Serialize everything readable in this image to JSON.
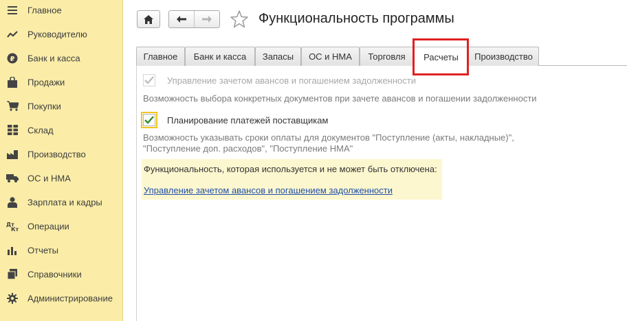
{
  "sidebar": {
    "items": [
      {
        "label": "Главное",
        "icon": "menu-icon"
      },
      {
        "label": "Руководителю",
        "icon": "trend-icon"
      },
      {
        "label": "Банк и касса",
        "icon": "ruble-icon"
      },
      {
        "label": "Продажи",
        "icon": "bag-icon"
      },
      {
        "label": "Покупки",
        "icon": "cart-icon"
      },
      {
        "label": "Склад",
        "icon": "grid-icon"
      },
      {
        "label": "Производство",
        "icon": "factory-icon"
      },
      {
        "label": "ОС и НМА",
        "icon": "truck-icon"
      },
      {
        "label": "Зарплата и кадры",
        "icon": "person-icon"
      },
      {
        "label": "Операции",
        "icon": "dt-kt-icon"
      },
      {
        "label": "Отчеты",
        "icon": "bar-chart-icon"
      },
      {
        "label": "Справочники",
        "icon": "books-icon"
      },
      {
        "label": "Администрирование",
        "icon": "gear-icon"
      }
    ]
  },
  "header": {
    "title": "Функциональность программы"
  },
  "tabs": [
    {
      "label": "Главное"
    },
    {
      "label": "Банк и касса"
    },
    {
      "label": "Запасы"
    },
    {
      "label": "ОС и НМА"
    },
    {
      "label": "Торговля"
    },
    {
      "label": "Расчеты"
    },
    {
      "label": "Производство"
    }
  ],
  "active_tab": "Расчеты",
  "content": {
    "option1": {
      "label": "Управление зачетом авансов и погашением задолженности",
      "checked": true,
      "enabled": false,
      "hint": "Возможность выбора конкретных документов при зачете авансов и погашении задолженности"
    },
    "option2": {
      "label": "Планирование платежей поставщикам",
      "checked": true,
      "enabled": true,
      "hint_line1": "Возможность указывать сроки оплаты для документов \"Поступление (акты, накладные)\",",
      "hint_line2": "\"Поступление доп. расходов\", \"Поступление НМА\""
    },
    "info": {
      "text": "Функциональность, которая используется и не может быть отключена:",
      "link": "Управление зачетом авансов и погашением задолженности"
    }
  },
  "colors": {
    "sidebar_bg": "#fbeda8",
    "info_bg": "#fdf7cf",
    "highlight": "#e02020",
    "link": "#1f4fa8",
    "check": "#2d8a2d"
  }
}
